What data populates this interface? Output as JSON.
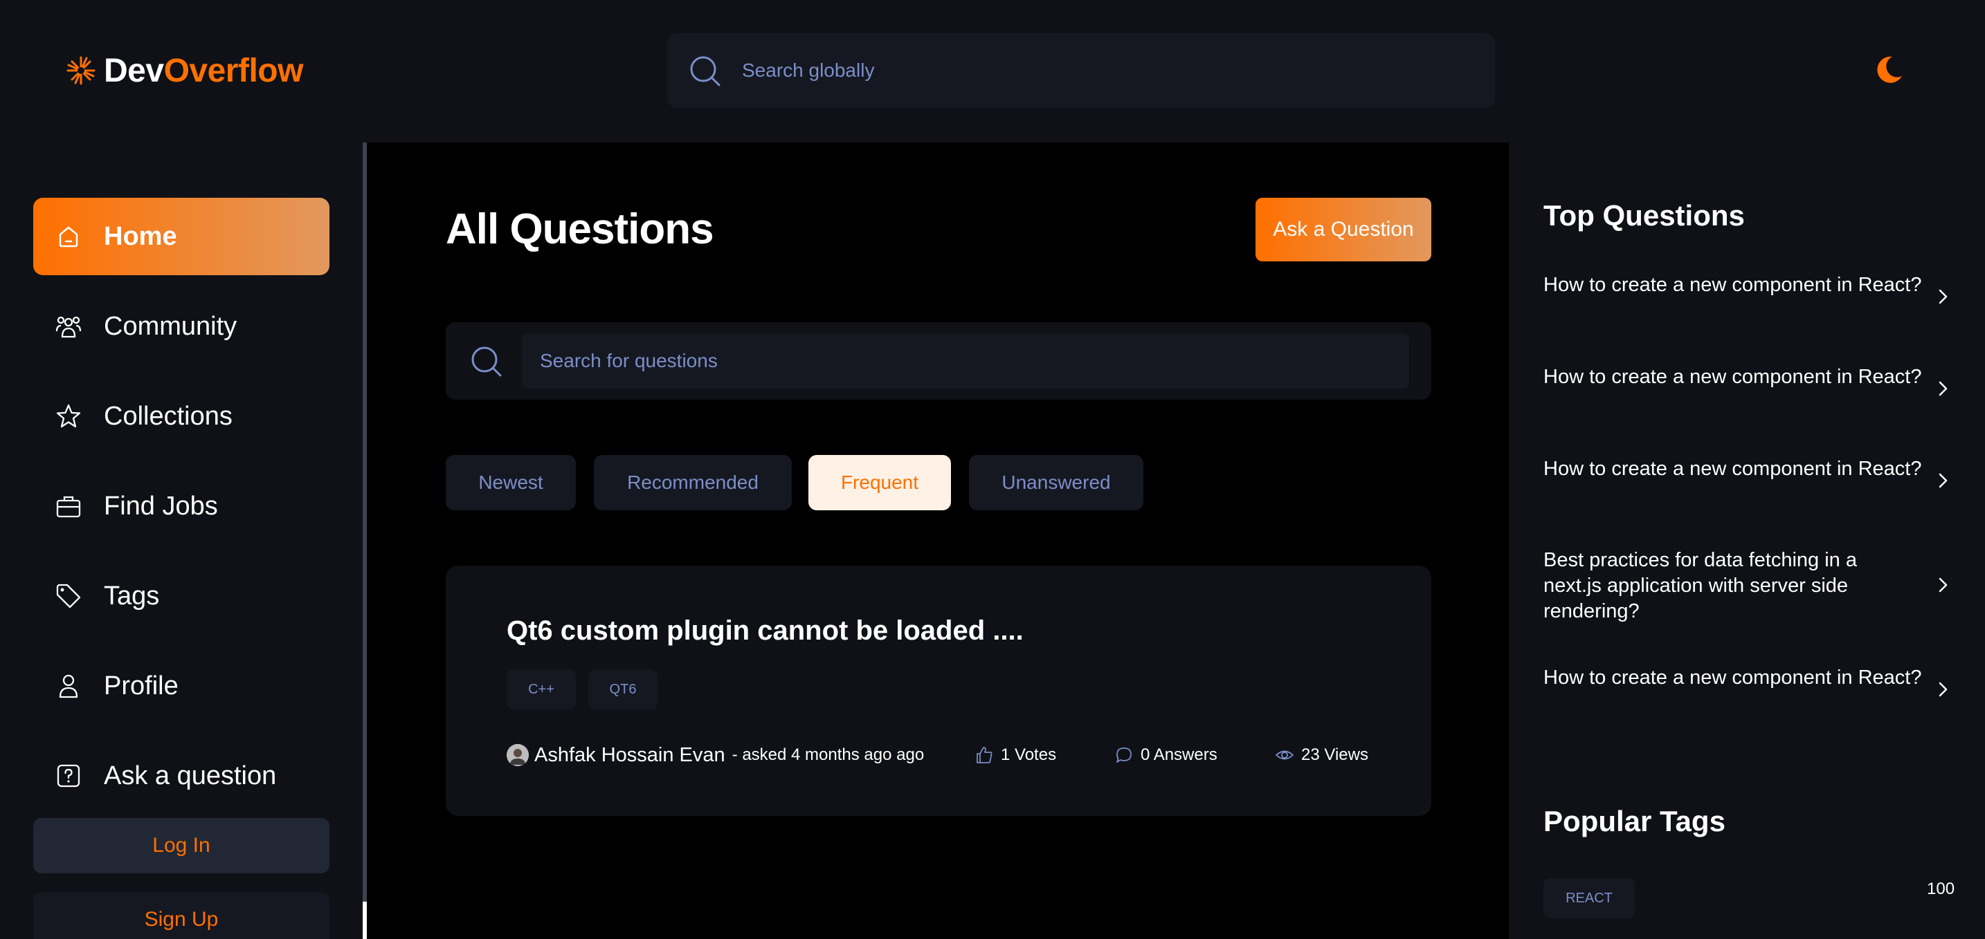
{
  "brand": {
    "name_part1": "Dev",
    "name_part2": "Overflow",
    "accent": "#ff7000"
  },
  "header": {
    "global_search_placeholder": "Search globally",
    "theme_icon": "moon-icon"
  },
  "sidebar": {
    "items": [
      {
        "label": "Home",
        "icon": "home-icon",
        "active": true
      },
      {
        "label": "Community",
        "icon": "users-icon",
        "active": false
      },
      {
        "label": "Collections",
        "icon": "star-icon",
        "active": false
      },
      {
        "label": "Find Jobs",
        "icon": "briefcase-icon",
        "active": false
      },
      {
        "label": "Tags",
        "icon": "tag-icon",
        "active": false
      },
      {
        "label": "Profile",
        "icon": "user-icon",
        "active": false
      },
      {
        "label": "Ask a question",
        "icon": "question-icon",
        "active": false
      }
    ],
    "login_label": "Log In",
    "signup_label": "Sign Up"
  },
  "main": {
    "title": "All Questions",
    "ask_button": "Ask a Question",
    "search_placeholder": "Search for questions",
    "filters": [
      {
        "label": "Newest",
        "active": false
      },
      {
        "label": "Recommended",
        "active": false
      },
      {
        "label": "Frequent",
        "active": true
      },
      {
        "label": "Unanswered",
        "active": false
      }
    ],
    "questions": [
      {
        "title": "Qt6 custom plugin cannot be loaded ....",
        "tags": [
          "C++",
          "QT6"
        ],
        "author": "Ashfak Hossain Evan",
        "asked": "- asked 4 months ago ago",
        "votes": "1 Votes",
        "answers": "0 Answers",
        "views": "23 Views"
      }
    ]
  },
  "rightbar": {
    "top_questions_heading": "Top Questions",
    "top_questions": [
      "How to create a new component in React?",
      "How to create a new component in React?",
      "How to create a new component in React?",
      "Best practices for data fetching in a next.js application with server side rendering?",
      "How to create a new component in React?"
    ],
    "popular_tags_heading": "Popular Tags",
    "popular_tags": [
      {
        "name": "REACT",
        "count": "100"
      }
    ]
  }
}
